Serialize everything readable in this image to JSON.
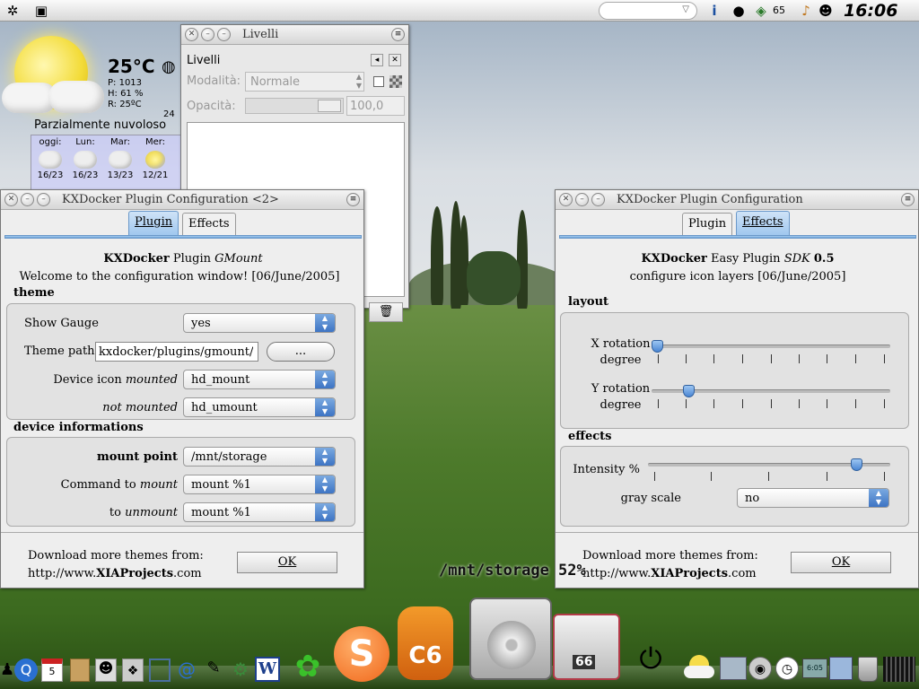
{
  "top_panel": {
    "battery_count": "65",
    "clock": "16:06",
    "icons": [
      "system-menu-icon",
      "window-list-icon",
      "combo-arrow-icon",
      "info-icon",
      "bomb-icon",
      "network-icon",
      "audio-icon",
      "tux-icon"
    ]
  },
  "weather": {
    "temperature": "25°C",
    "pressure": "P: 1013",
    "humidity": "H: 61 %",
    "real": "R: 25ºC",
    "description": "Parzialmente nuvoloso",
    "extra": "24",
    "days": [
      {
        "name": "oggi:",
        "range": "16/23"
      },
      {
        "name": "Lun:",
        "range": "16/23"
      },
      {
        "name": "Mar:",
        "range": "13/23"
      },
      {
        "name": "Mer:",
        "range": "12/21"
      }
    ]
  },
  "livelli": {
    "title": "Livelli",
    "panel_title": "Livelli",
    "mode_label": "Modalità:",
    "mode_value": "Normale",
    "opacity_label": "Opacità:",
    "opacity_value": "100,0"
  },
  "gmount_window": {
    "title": "KXDocker Plugin Configuration <2>",
    "tabs": {
      "plugin": "Plugin",
      "effects": "Effects"
    },
    "heading_bold": "KXDocker",
    "heading_rest": "Plugin",
    "heading_italic": "GMount",
    "welcome": "Welcome to the configuration window! [06/June/2005]",
    "theme_section": "theme",
    "show_gauge_label": "Show Gauge",
    "show_gauge_value": "yes",
    "theme_path_label": "Theme path",
    "theme_path_value": "kxdocker/plugins/gmount/",
    "browse_button": "...",
    "device_icon_label": "Device icon",
    "mounted_label": "mounted",
    "mounted_value": "hd_mount",
    "not_mounted_label": "not mounted",
    "not_mounted_value": "hd_umount",
    "device_section": "device informations",
    "mount_point_label": "mount point",
    "mount_point_value": "/mnt/storage",
    "command_label": "Command to",
    "command_italic": "mount",
    "command_value": "mount %1",
    "to_label": "to",
    "unmount_italic": "unmount",
    "unmount_value": "mount %1",
    "download_text": "Download more themes from:",
    "url_prefix": "http://www.",
    "url_bold": "XIAProjects",
    "url_suffix": ".com",
    "ok_button": "OK"
  },
  "sdk_window": {
    "title": "KXDocker Plugin Configuration",
    "tabs": {
      "plugin": "Plugin",
      "effects": "Effects"
    },
    "heading_bold": "KXDocker",
    "heading_rest": "Easy Plugin",
    "heading_italic": "SDK",
    "heading_version": "0.5",
    "subheading": "configure icon layers [06/June/2005]",
    "layout_section": "layout",
    "x_rotation_label": "X rotation",
    "x_rotation_unit": "degree",
    "x_rotation_level": 0.0,
    "y_rotation_label": "Y rotation",
    "y_rotation_unit": "degree",
    "y_rotation_level": 0.14,
    "effects_section": "effects",
    "intensity_label": "Intensity %",
    "intensity_level": 0.88,
    "gray_scale_label": "gray scale",
    "gray_scale_value": "no",
    "download_text": "Download more themes from:",
    "url_prefix": "http://www.",
    "url_bold": "XIAProjects",
    "url_suffix": ".com",
    "ok_button": "OK"
  },
  "overlay": {
    "mount_status": "/mnt/storage 52%"
  },
  "dock": {
    "calendar_day": "5",
    "counter": "66",
    "clock_small": "6:05",
    "word_letter": "W"
  }
}
